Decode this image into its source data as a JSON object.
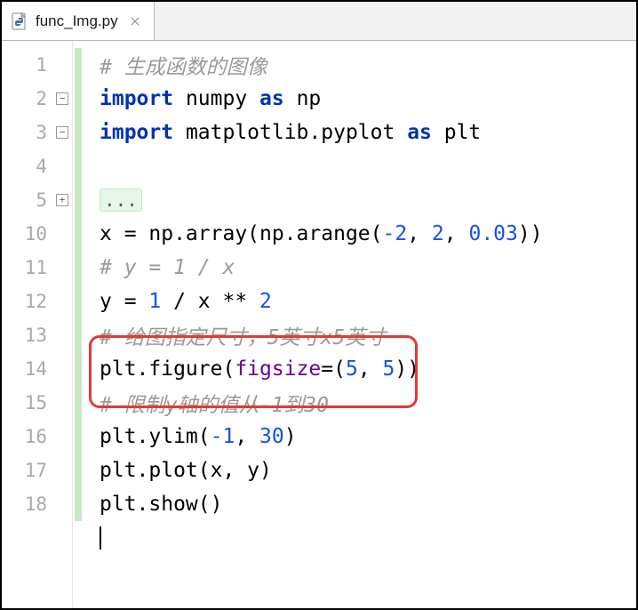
{
  "tab": {
    "filename": "func_Img.py"
  },
  "lines": {
    "l1": {
      "num": "1",
      "comment": "# 生成函数的图像"
    },
    "l2": {
      "num": "2",
      "kw1": "import ",
      "t1": "numpy ",
      "kw2": "as ",
      "t2": "np"
    },
    "l3": {
      "num": "3",
      "kw1": "import ",
      "t1": "matplotlib.pyplot ",
      "kw2": "as ",
      "t2": "plt"
    },
    "l4": {
      "num": "4"
    },
    "l5": {
      "num": "5",
      "fold": "..."
    },
    "l10": {
      "num": "10",
      "t1": "x = np.array(np.arange(",
      "n1": "-2",
      "c1": ", ",
      "n2": "2",
      "c2": ", ",
      "n3": "0.03",
      "t2": "))"
    },
    "l11": {
      "num": "11",
      "comment": "# y = 1 / x"
    },
    "l12": {
      "num": "12",
      "t1": "y = ",
      "n1": "1 ",
      "t2": "/ x ** ",
      "n2": "2"
    },
    "l13": {
      "num": "13",
      "comment": "# 给图指定尺寸，5英寸x5英寸"
    },
    "l14": {
      "num": "14",
      "t1": "plt.figure(",
      "p1": "figsize",
      "t2": "=(",
      "n1": "5",
      "c1": ", ",
      "n2": "5",
      "t3": "))"
    },
    "l15": {
      "num": "15",
      "comment": "# 限制y轴的值从-1到30"
    },
    "l16": {
      "num": "16",
      "t1": "plt.ylim(",
      "n1": "-1",
      "c1": ", ",
      "n2": "30",
      "t2": ")"
    },
    "l17": {
      "num": "17",
      "t1": "plt.plot(x, y)"
    },
    "l18": {
      "num": "18",
      "t1": "plt.show()"
    }
  }
}
